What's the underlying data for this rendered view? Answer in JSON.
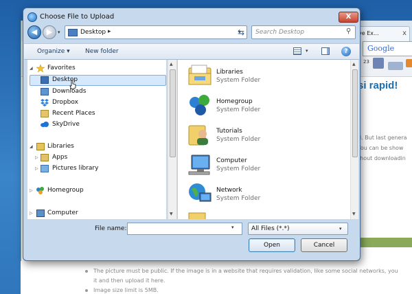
{
  "dialog": {
    "title": "Choose File to Upload",
    "close_label": "X"
  },
  "address": {
    "location": "Desktop",
    "separator": "▸",
    "search_placeholder": "Search Desktop"
  },
  "toolbar": {
    "organize": "Organize ▾",
    "new_folder": "New folder",
    "help": "?"
  },
  "nav_pane": {
    "items": [
      {
        "label": "Favorites"
      },
      {
        "label": "Desktop"
      },
      {
        "label": "Downloads"
      },
      {
        "label": "Dropbox"
      },
      {
        "label": "Recent Places"
      },
      {
        "label": "SkyDrive"
      },
      {
        "label": "Libraries"
      },
      {
        "label": "Apps"
      },
      {
        "label": "Pictures library"
      },
      {
        "label": "Homegroup"
      },
      {
        "label": "Computer"
      }
    ]
  },
  "files": [
    {
      "name": "Libraries",
      "type": "System Folder"
    },
    {
      "name": "Homegroup",
      "type": "System Folder"
    },
    {
      "name": "Tutorials",
      "type": "System Folder"
    },
    {
      "name": "Computer",
      "type": "System Folder"
    },
    {
      "name": "Network",
      "type": "System Folder"
    }
  ],
  "footer": {
    "file_name_label": "File name:",
    "file_name_value": "",
    "filter_value": "All Files (*.*)",
    "open_label": "Open",
    "cancel_label": "Cancel"
  },
  "background_page": {
    "tab_label": "ve Ex...",
    "tab_close": "x",
    "google": "Google",
    "count": "23",
    "headline": "si rapid!",
    "side_lines": [
      "d. But last genera",
      "You can be show",
      "thout downloadin"
    ],
    "bullets": [
      "The picture must be public. If the image is in a website that requires validation, like some social networks, you",
      "Image size limit is 5MB."
    ],
    "bullet_cont": "it and then upload it here."
  },
  "colors": {
    "accent": "#3c7fb1",
    "selection": "#d6e8fb",
    "close": "#c9432d"
  }
}
